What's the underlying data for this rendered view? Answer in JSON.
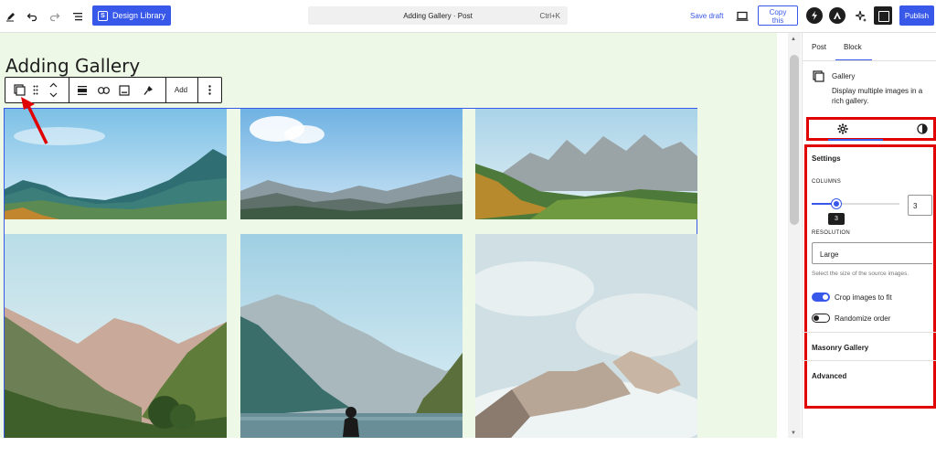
{
  "topbar": {
    "design_library_label": "Design Library",
    "document_title": "Adding Gallery · Post",
    "shortcut": "Ctrl+K",
    "save_draft_label": "Save draft",
    "copy_this_line1": "Copy",
    "copy_this_line2": "this",
    "publish_label": "Publish"
  },
  "canvas": {
    "page_title": "Adding Gallery",
    "toolbar": {
      "add_label": "Add"
    }
  },
  "sidebar": {
    "tabs": [
      {
        "label": "Post"
      },
      {
        "label": "Block"
      }
    ],
    "block": {
      "name": "Gallery",
      "description": "Display multiple images in a rich gallery."
    },
    "settings": {
      "title": "Settings",
      "columns_label": "COLUMNS",
      "columns_value": "3",
      "columns_tooltip": "3",
      "resolution_label": "RESOLUTION",
      "resolution_value": "Large",
      "resolution_help": "Select the size of the source images.",
      "crop_label": "Crop images to fit",
      "crop_on": true,
      "randomize_label": "Randomize order",
      "randomize_on": false
    },
    "panels": [
      {
        "label": "Masonry Gallery"
      },
      {
        "label": "Advanced"
      }
    ]
  },
  "colors": {
    "accent": "#3858e9",
    "annotation": "#e00000",
    "canvas_bg": "#eef8e6"
  }
}
